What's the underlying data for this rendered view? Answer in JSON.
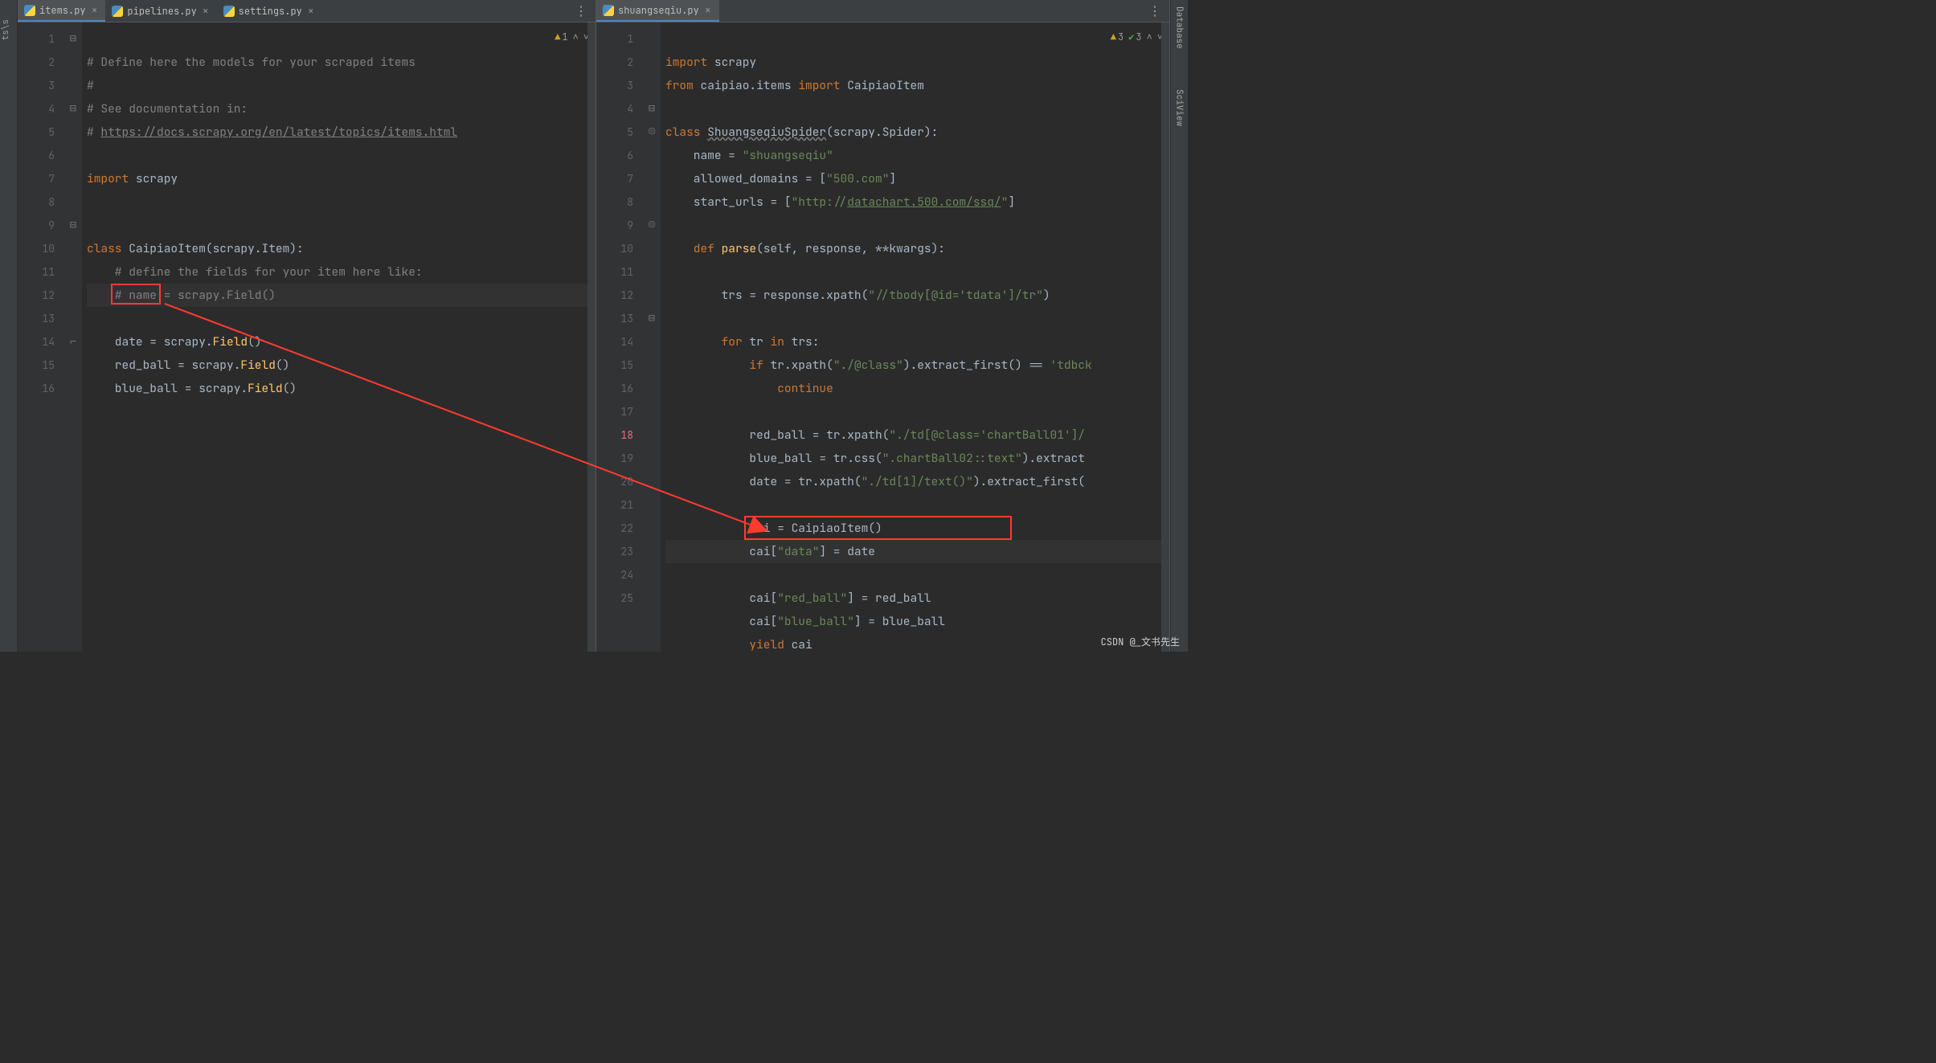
{
  "left_strip_label": "ts\\s",
  "left_pane": {
    "tabs": [
      {
        "label": "items.py",
        "active": true
      },
      {
        "label": "pipelines.py",
        "active": false
      },
      {
        "label": "settings.py",
        "active": false
      }
    ],
    "inspection": {
      "warnings": "1"
    },
    "line_numbers": [
      "1",
      "2",
      "3",
      "4",
      "5",
      "6",
      "7",
      "8",
      "9",
      "10",
      "11",
      "12",
      "13",
      "14",
      "15",
      "16"
    ],
    "code": {
      "l1": "# Define here the models for your scraped items",
      "l2": "#",
      "l3": "# See documentation in:",
      "l4_prefix": "# ",
      "l4_link": "https://docs.scrapy.org/en/latest/topics/items.html",
      "l6_kw": "import",
      "l6_mod": " scrapy",
      "l9_kw": "class ",
      "l9_name": "CaipiaoItem",
      "l9_paren": "(scrapy.Item):",
      "l10": "    # define the fields for your item here like:",
      "l11": "    # name = scrapy.Field()",
      "l12_field": "    date",
      "l12_rest": " = scrapy.",
      "l12_call": "Field",
      "l12_tail": "()",
      "l13_field": "    red_ball = scrapy.",
      "l13_call": "Field",
      "l13_tail": "()",
      "l14_field": "    blue_ball = scrapy.",
      "l14_call": "Field",
      "l14_tail": "()"
    }
  },
  "right_pane": {
    "tabs": [
      {
        "label": "shuangseqiu.py",
        "active": true
      }
    ],
    "inspection": {
      "warnings": "3",
      "ok": "3"
    },
    "line_numbers": [
      "1",
      "2",
      "3",
      "4",
      "5",
      "6",
      "7",
      "8",
      "9",
      "10",
      "11",
      "12",
      "13",
      "14",
      "15",
      "16",
      "17",
      "18",
      "19",
      "20",
      "21",
      "22",
      "23",
      "24",
      "25"
    ],
    "code": {
      "l1_kw": "import",
      "l1_mod": " scrapy",
      "l2_kw1": "from",
      "l2_mod": " caipiao.items ",
      "l2_kw2": "import",
      "l2_name": " CaipiaoItem",
      "l4_kw": "class ",
      "l4_name": "ShuangseqiuSpider",
      "l4_paren": "(scrapy.Spider):",
      "l5_name": "    name = ",
      "l5_str": "\"shuangseqiu\"",
      "l6_name": "    allowed_domains = [",
      "l6_str": "\"500.com\"",
      "l6_tail": "]",
      "l7_name": "    start_urls = [",
      "l7_str1": "\"http://",
      "l7_link": "datachart.500.com/ssq/",
      "l7_str2": "\"",
      "l7_tail": "]",
      "l9_kw": "    def ",
      "l9_fn": "parse",
      "l9_sig": "(self, response, **kwargs):",
      "l11": "        trs = response.xpath(",
      "l11_str": "\"//tbody[@id='tdata']/tr\"",
      "l11_tail": ")",
      "l13_kw": "        for ",
      "l13_v1": "tr ",
      "l13_kw2": "in ",
      "l13_v2": "trs:",
      "l14_kw": "            if ",
      "l14_expr": "tr.xpath(",
      "l14_str": "\"./@class\"",
      "l14_mid": ").extract_first() == ",
      "l14_str2": "'tdbck",
      "l15_kw": "                continue",
      "l17": "            red_ball = tr.xpath(",
      "l17_str": "\"./td[@class='chartBall01']/",
      "l18": "            blue_ball = tr.css(",
      "l18_str": "\".chartBall02::text\"",
      "l18_tail": ").extract",
      "l19": "            date = tr.xpath(",
      "l19_str": "\"./td[1]/text()\"",
      "l19_tail": ").extract_first(",
      "l21": "            cai = CaipiaoItem()",
      "l22_a": "            cai[",
      "l22_str": "\"data\"",
      "l22_b": "] = date",
      "l23_a": "            cai[",
      "l23_str": "\"red_ball\"",
      "l23_b": "] = red_ball",
      "l24_a": "            cai[",
      "l24_str": "\"blue_ball\"",
      "l24_b": "] = blue_ball",
      "l25_kw": "            yield ",
      "l25_v": "cai"
    }
  },
  "right_rail": {
    "db": "Database",
    "sci": "SciView"
  },
  "watermark": "CSDN @_文书先生"
}
